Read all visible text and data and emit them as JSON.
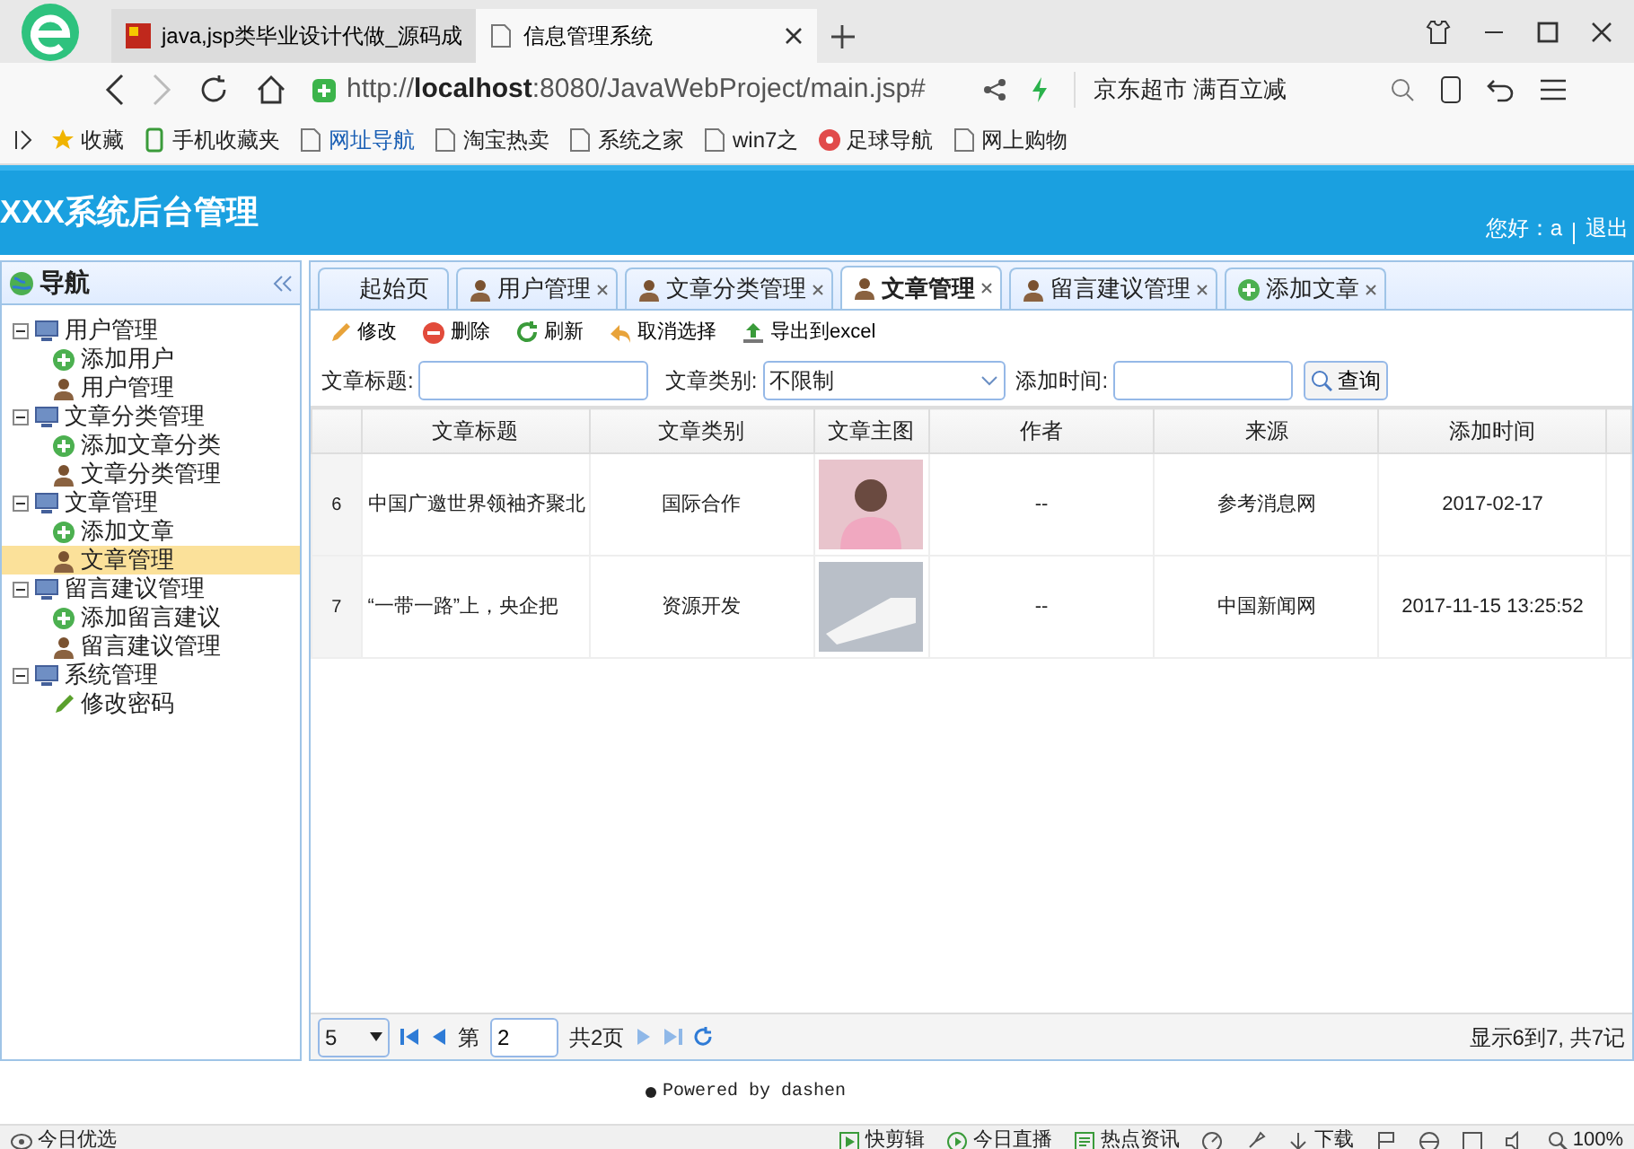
{
  "browser": {
    "tabs": [
      {
        "title": "java,jsp类毕业设计代做_源码成",
        "selected": false,
        "kind": "site"
      },
      {
        "title": "信息管理系统",
        "selected": true,
        "kind": "page"
      }
    ],
    "url_prefix": "http://",
    "url_host": "localhost",
    "url_rest": ":8080/JavaWebProject/main.jsp#",
    "search_text": "京东超市 满百立减",
    "bookmarks": [
      {
        "label": "收藏",
        "kind": "star"
      },
      {
        "label": "手机收藏夹",
        "kind": "phone"
      },
      {
        "label": "网址导航",
        "kind": "page"
      },
      {
        "label": "淘宝热卖",
        "kind": "page"
      },
      {
        "label": "系统之家",
        "kind": "page"
      },
      {
        "label": "win7之",
        "kind": "page"
      },
      {
        "label": "足球导航",
        "kind": "ball"
      },
      {
        "label": "网上购物",
        "kind": "page"
      }
    ]
  },
  "app": {
    "title": "XXX系统后台管理",
    "greeting": "您好：a",
    "logout": "退出",
    "nav_title": "导航",
    "tree": [
      {
        "label": "用户管理",
        "kind": "folder",
        "selected": false,
        "children": [
          {
            "label": "添加用户",
            "kind": "add",
            "selected": false
          },
          {
            "label": "用户管理",
            "kind": "user",
            "selected": false
          }
        ]
      },
      {
        "label": "文章分类管理",
        "kind": "folder",
        "selected": false,
        "children": [
          {
            "label": "添加文章分类",
            "kind": "add",
            "selected": false
          },
          {
            "label": "文章分类管理",
            "kind": "user",
            "selected": false
          }
        ]
      },
      {
        "label": "文章管理",
        "kind": "folder",
        "selected": false,
        "children": [
          {
            "label": "添加文章",
            "kind": "add",
            "selected": false
          },
          {
            "label": "文章管理",
            "kind": "user",
            "selected": true
          }
        ]
      },
      {
        "label": "留言建议管理",
        "kind": "folder",
        "selected": false,
        "children": [
          {
            "label": "添加留言建议",
            "kind": "add",
            "selected": false
          },
          {
            "label": "留言建议管理",
            "kind": "user",
            "selected": false
          }
        ]
      },
      {
        "label": "系统管理",
        "kind": "folder",
        "selected": false,
        "children": [
          {
            "label": "修改密码",
            "kind": "edit",
            "selected": false
          }
        ]
      }
    ],
    "tabs": [
      {
        "label": "起始页",
        "kind": "home",
        "selected": false
      },
      {
        "label": "用户管理",
        "kind": "user",
        "selected": false
      },
      {
        "label": "文章分类管理",
        "kind": "user",
        "selected": false
      },
      {
        "label": "文章管理",
        "kind": "user",
        "selected": true
      },
      {
        "label": "留言建议管理",
        "kind": "user",
        "selected": false
      },
      {
        "label": "添加文章",
        "kind": "add",
        "selected": false
      }
    ],
    "toolbar": [
      {
        "label": "修改",
        "kind": "edit"
      },
      {
        "label": "删除",
        "kind": "delete"
      },
      {
        "label": "刷新",
        "kind": "refresh"
      },
      {
        "label": "取消选择",
        "kind": "undo"
      },
      {
        "label": "导出到excel",
        "kind": "export"
      }
    ],
    "filters": {
      "title_label": "文章标题:",
      "category_label": "文章类别:",
      "category_value": "不限制",
      "time_label": "添加时间:",
      "search_button": "查询"
    },
    "table": {
      "columns": [
        "文章标题",
        "文章类别",
        "文章主图",
        "作者",
        "来源",
        "添加时间"
      ],
      "rows": [
        {
          "index": "6",
          "cells": [
            "中国广邀世界领袖齐聚北",
            "国际合作",
            "",
            "--",
            "参考消息网",
            "2017-02-17"
          ],
          "kind": "person"
        },
        {
          "index": "7",
          "cells": [
            "“一带一路”上，央企把",
            "资源开发",
            "",
            "--",
            "中国新闻网",
            "2017-11-15 13:25:52"
          ],
          "kind": "train"
        }
      ]
    },
    "pager": {
      "page_size": "5",
      "page_prefix": "第",
      "page": "2",
      "page_total": "共2页",
      "info": "显示6到7, 共7记"
    },
    "footer": "Powered by dashen"
  },
  "status_bar": {
    "left": "今日优选",
    "items": [
      {
        "label": "快剪辑",
        "kind": "clip"
      },
      {
        "label": "今日直播",
        "kind": "play"
      },
      {
        "label": "热点资讯",
        "kind": "news"
      },
      {
        "label": "下载",
        "kind": "download"
      }
    ],
    "zoom": "100%"
  }
}
